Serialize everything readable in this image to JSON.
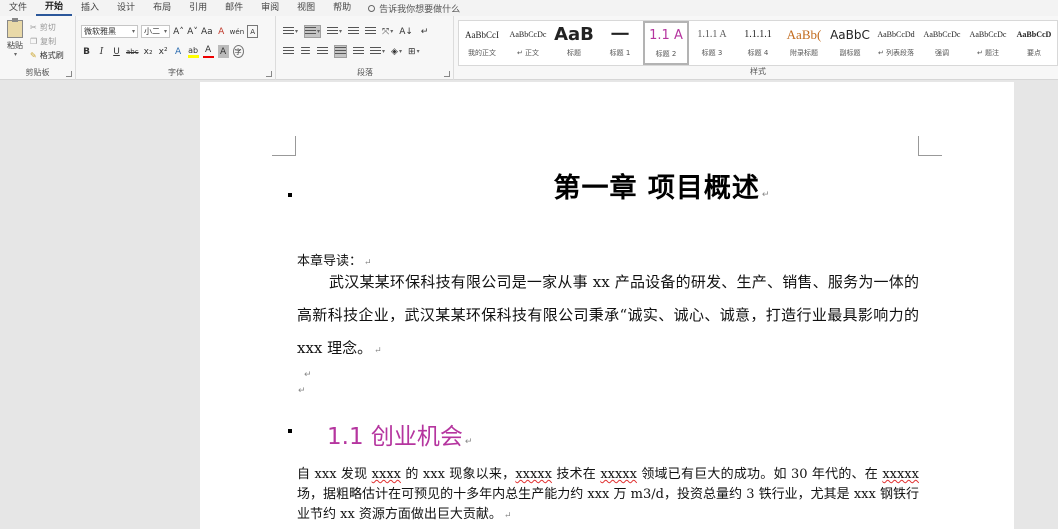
{
  "menu": {
    "tabs": [
      "文件",
      "开始",
      "插入",
      "设计",
      "布局",
      "引用",
      "邮件",
      "审阅",
      "视图",
      "帮助"
    ],
    "active_tab": "开始",
    "tell_me": "告诉我你想要做什么"
  },
  "clipboard": {
    "paste": "粘贴",
    "cut": "剪切",
    "copy": "复制",
    "format_painter": "格式刷",
    "label": "剪贴板"
  },
  "font": {
    "family": "微软雅黑",
    "size": "小二",
    "grow": "A˄",
    "shrink": "A˅",
    "case": "Aa",
    "clear": "A",
    "phonetic": "wén",
    "border_char": "A",
    "bold": "B",
    "italic": "I",
    "underline": "U",
    "strike": "abc",
    "subscript": "x₂",
    "superscript": "x²",
    "effects": "A",
    "highlight": "ab",
    "color": "A",
    "shade": "A",
    "enclose": "字",
    "label": "字体"
  },
  "paragraph": {
    "sort": "A↓",
    "marks": "↵",
    "label": "段落"
  },
  "styles": {
    "label": "样式",
    "items": [
      {
        "preview": "AaBbCcI",
        "name": "我的正文"
      },
      {
        "preview": "AaBbCcDc",
        "name": "↵ 正文"
      },
      {
        "preview": "AaB",
        "name": "标题"
      },
      {
        "preview": "一",
        "name": "标题 1"
      },
      {
        "preview": "1.1 A",
        "name": "标题 2"
      },
      {
        "preview": "1.1.1 A",
        "name": "标题 3"
      },
      {
        "preview": "1.1.1.1",
        "name": "标题 4"
      },
      {
        "preview": "AaBb(",
        "name": "附录标题"
      },
      {
        "preview": "AaBbC",
        "name": "副标题"
      },
      {
        "preview": "AaBbCcDd",
        "name": "↵ 列表段落"
      },
      {
        "preview": "AaBbCcDc",
        "name": "强调"
      },
      {
        "preview": "AaBbCcDc",
        "name": "↵ 题注"
      },
      {
        "preview": "AaBbCcD",
        "name": "要点"
      }
    ],
    "selected_index": 4
  },
  "document": {
    "chapter_title": "第一章  项目概述",
    "guide_label": "本章导读：",
    "paragraph1": "武汉某某环保科技有限公司是一家从事 xx 产品设备的研发、生产、销售、服务为一体的高新科技企业，武汉某某环保科技有限公司秉承“诚实、诚心、诚意，打造行业最具影响力的 xxx 理念。",
    "section_title": "1.1 创业机会",
    "p2_a": "自 xxx 发现 ",
    "p2_b": "xxxx",
    "p2_c": " 的 xxx 现象以来，",
    "p2_d": "xxxxx",
    "p2_e": " 技术在 ",
    "p2_f": "xxxxx",
    "p2_g": " 领域已有巨大的成功。如 30 年代的、在 ",
    "p2_h": "xxxxx",
    "p2_i": " 场，据粗略估计在可预见的十多年内总生产能力约 xxx 万 m3/d，投资总量约 3 铁行业，尤其是 xxx 钢铁行业节约 xx 资源方面做出巨大贡献。",
    "para_mark": "↵"
  }
}
